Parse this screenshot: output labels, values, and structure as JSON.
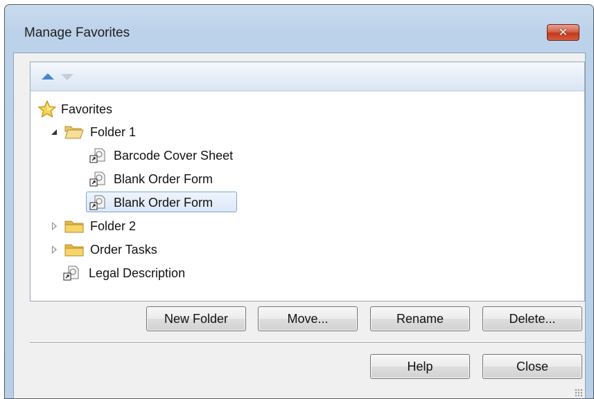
{
  "window": {
    "title": "Manage Favorites",
    "close_glyph": "✕"
  },
  "toolbar": {
    "move_up_icon": "arrow-up-icon",
    "move_down_icon": "arrow-down-icon"
  },
  "tree": {
    "root": {
      "label": "Favorites",
      "icon": "star-icon"
    },
    "folder1": {
      "label": "Folder 1",
      "icon": "folder-open-icon",
      "expanded": true
    },
    "folder1_items": [
      {
        "label": "Barcode Cover Sheet",
        "icon": "shortcut-icon"
      },
      {
        "label": "Blank Order Form",
        "icon": "shortcut-icon"
      },
      {
        "label": "Blank Order Form",
        "icon": "shortcut-icon",
        "selected": true
      }
    ],
    "folder2": {
      "label": "Folder 2",
      "icon": "folder-closed-icon",
      "expanded": false
    },
    "order_tasks": {
      "label": "Order Tasks",
      "icon": "folder-closed-icon",
      "expanded": false
    },
    "legal": {
      "label": "Legal Description",
      "icon": "shortcut-icon"
    }
  },
  "actions": {
    "new_folder": "New Folder",
    "move": "Move...",
    "rename": "Rename",
    "delete": "Delete..."
  },
  "footer": {
    "help": "Help",
    "close": "Close"
  },
  "colors": {
    "title_bar": "#c2d6ec",
    "close_button": "#c7432a",
    "selection_border": "#7da2ce",
    "folder_yellow": "#f2c84b"
  }
}
